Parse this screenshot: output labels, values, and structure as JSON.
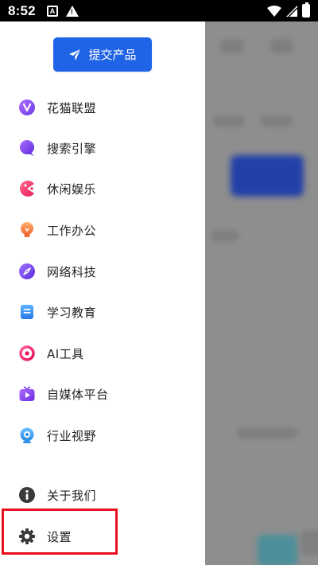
{
  "status_bar": {
    "time": "8:52",
    "icons": [
      "notification-a-icon",
      "warning-icon",
      "wifi-icon",
      "signal-icon",
      "battery-icon"
    ]
  },
  "drawer": {
    "submit_button": {
      "label": "提交产品",
      "icon": "send-icon",
      "color": "#1f63e6"
    },
    "categories": [
      {
        "label": "花猫联盟",
        "icon": "v-badge-icon",
        "color": "#8a4ff0"
      },
      {
        "label": "搜索引擎",
        "icon": "chat-bubble-icon",
        "color": "#7a3cf0"
      },
      {
        "label": "休闲娱乐",
        "icon": "pacman-icon",
        "color": "#f03070"
      },
      {
        "label": "工作办公",
        "icon": "lightbulb-icon",
        "color": "#f07a3a"
      },
      {
        "label": "网络科技",
        "icon": "compass-icon",
        "color": "#6a3de8"
      },
      {
        "label": "学习教育",
        "icon": "document-icon",
        "color": "#2a8cf0"
      },
      {
        "label": "AI工具",
        "icon": "ring-icon",
        "color": "#f02a6a"
      },
      {
        "label": "自媒体平台",
        "icon": "tv-play-icon",
        "color": "#7a3cf0"
      },
      {
        "label": "行业视野",
        "icon": "webcam-icon",
        "color": "#2a9cf0"
      }
    ],
    "bottom_items": [
      {
        "label": "关于我们",
        "icon": "info-icon"
      },
      {
        "label": "设置",
        "icon": "gear-icon"
      }
    ],
    "highlight_color": "#e8101e"
  }
}
